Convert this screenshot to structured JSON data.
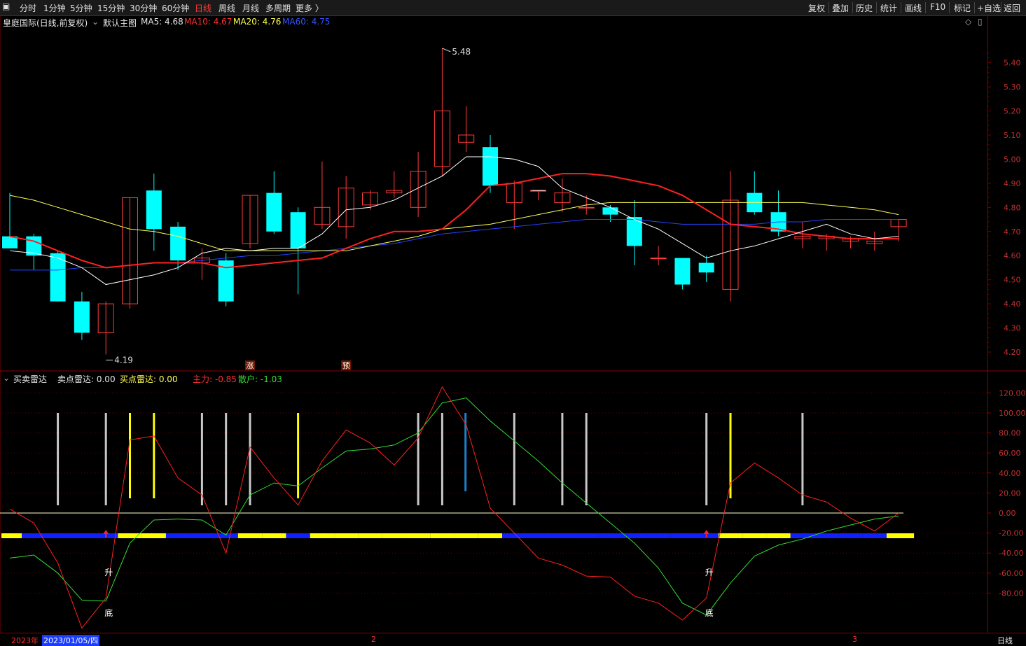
{
  "toolbar": {
    "periods": [
      "分时",
      "1分钟",
      "5分钟",
      "15分钟",
      "30分钟",
      "60分钟",
      "日线",
      "周线",
      "月线",
      "多周期",
      "更多 〉"
    ],
    "active_period": "日线",
    "right_buttons": [
      "复权",
      "叠加",
      "历史",
      "统计",
      "画线",
      "F10",
      "标记",
      "+自选",
      "返回"
    ]
  },
  "main_title": {
    "stock": "皇庭国际(日线,前复权)",
    "template": "默认主图",
    "ma5": "MA5: 4.68",
    "ma10": "MA10: 4.67",
    "ma20": "MA20: 4.76",
    "ma60": "MA60: 4.75"
  },
  "indicator_title": {
    "name": "买卖雷达",
    "sell": "卖点雷达: 0.00",
    "buy": "买点雷达: 0.00",
    "main_force": "主力: -0.85",
    "retail": "散户: -1.03"
  },
  "colors": {
    "up": "#ff3b3b",
    "down": "#00ffff",
    "ma5": "#ffffff",
    "ma10": "#ff2020",
    "ma20": "#ffff55",
    "ma60": "#2244ff",
    "main_force": "#ff2020",
    "retail": "#33dd33"
  },
  "bottom": {
    "year": "2023年",
    "date": "2023/01/05/四",
    "month2": "2",
    "month3": "3",
    "period": "日线"
  },
  "chart_data": [
    {
      "type": "candlestick",
      "y_ticks": [
        "5.40",
        "5.30",
        "5.20",
        "5.10",
        "5.00",
        "4.90",
        "4.80",
        "4.70",
        "4.60",
        "4.50",
        "4.40",
        "4.30",
        "4.20"
      ],
      "ylim": [
        4.15,
        5.5
      ],
      "candles": [
        {
          "o": 4.68,
          "h": 4.86,
          "l": 4.63,
          "c": 4.63
        },
        {
          "o": 4.68,
          "h": 4.69,
          "l": 4.54,
          "c": 4.6
        },
        {
          "o": 4.61,
          "h": 4.62,
          "l": 4.41,
          "c": 4.41
        },
        {
          "o": 4.41,
          "h": 4.45,
          "l": 4.25,
          "c": 4.28
        },
        {
          "o": 4.28,
          "h": 4.41,
          "l": 4.19,
          "c": 4.4
        },
        {
          "o": 4.4,
          "h": 4.84,
          "l": 4.38,
          "c": 4.84
        },
        {
          "o": 4.87,
          "h": 4.94,
          "l": 4.62,
          "c": 4.71
        },
        {
          "o": 4.72,
          "h": 4.74,
          "l": 4.54,
          "c": 4.58
        },
        {
          "o": 4.57,
          "h": 4.63,
          "l": 4.5,
          "c": 4.59
        },
        {
          "o": 4.58,
          "h": 4.61,
          "l": 4.39,
          "c": 4.41
        },
        {
          "o": 4.65,
          "h": 4.85,
          "l": 4.63,
          "c": 4.85
        },
        {
          "o": 4.86,
          "h": 4.95,
          "l": 4.69,
          "c": 4.7
        },
        {
          "o": 4.78,
          "h": 4.8,
          "l": 4.44,
          "c": 4.63
        },
        {
          "o": 4.73,
          "h": 4.99,
          "l": 4.71,
          "c": 4.8
        },
        {
          "o": 4.72,
          "h": 4.93,
          "l": 4.67,
          "c": 4.88
        },
        {
          "o": 4.81,
          "h": 4.87,
          "l": 4.79,
          "c": 4.86
        },
        {
          "o": 4.86,
          "h": 4.95,
          "l": 4.84,
          "c": 4.87
        },
        {
          "o": 4.8,
          "h": 5.03,
          "l": 4.76,
          "c": 4.95
        },
        {
          "o": 4.97,
          "h": 5.46,
          "l": 4.93,
          "c": 5.2
        },
        {
          "o": 5.07,
          "h": 5.22,
          "l": 5.03,
          "c": 5.1
        },
        {
          "o": 5.05,
          "h": 5.1,
          "l": 4.86,
          "c": 4.89
        },
        {
          "o": 4.82,
          "h": 4.91,
          "l": 4.71,
          "c": 4.9
        },
        {
          "o": 4.87,
          "h": 4.87,
          "l": 4.83,
          "c": 4.87
        },
        {
          "o": 4.82,
          "h": 4.92,
          "l": 4.78,
          "c": 4.86
        },
        {
          "o": 4.8,
          "h": 4.85,
          "l": 4.77,
          "c": 4.8
        },
        {
          "o": 4.8,
          "h": 4.81,
          "l": 4.74,
          "c": 4.77
        },
        {
          "o": 4.76,
          "h": 4.83,
          "l": 4.56,
          "c": 4.64
        },
        {
          "o": 4.59,
          "h": 4.64,
          "l": 4.56,
          "c": 4.59
        },
        {
          "o": 4.59,
          "h": 4.59,
          "l": 4.46,
          "c": 4.48
        },
        {
          "o": 4.57,
          "h": 4.6,
          "l": 4.49,
          "c": 4.53
        },
        {
          "o": 4.46,
          "h": 4.95,
          "l": 4.41,
          "c": 4.83
        },
        {
          "o": 4.86,
          "h": 4.95,
          "l": 4.77,
          "c": 4.78
        },
        {
          "o": 4.78,
          "h": 4.87,
          "l": 4.68,
          "c": 4.7
        },
        {
          "o": 4.67,
          "h": 4.74,
          "l": 4.63,
          "c": 4.68
        },
        {
          "o": 4.67,
          "h": 4.69,
          "l": 4.62,
          "c": 4.68
        },
        {
          "o": 4.66,
          "h": 4.68,
          "l": 4.63,
          "c": 4.67
        },
        {
          "o": 4.65,
          "h": 4.7,
          "l": 4.62,
          "c": 4.66
        },
        {
          "o": 4.72,
          "h": 4.75,
          "l": 4.66,
          "c": 4.75
        }
      ],
      "ma5": [
        4.62,
        4.61,
        4.59,
        4.55,
        4.48,
        4.5,
        4.52,
        4.55,
        4.61,
        4.63,
        4.62,
        4.63,
        4.63,
        4.69,
        4.79,
        4.8,
        4.83,
        4.88,
        4.93,
        5.01,
        5.01,
        5.0,
        4.97,
        4.88,
        4.84,
        4.8,
        4.75,
        4.71,
        4.65,
        4.59,
        4.62,
        4.64,
        4.67,
        4.7,
        4.73,
        4.69,
        4.67,
        4.68
      ],
      "ma10": [
        4.68,
        4.66,
        4.62,
        4.58,
        4.55,
        4.56,
        4.57,
        4.57,
        4.57,
        4.55,
        4.56,
        4.57,
        4.58,
        4.59,
        4.63,
        4.67,
        4.7,
        4.7,
        4.71,
        4.79,
        4.89,
        4.9,
        4.92,
        4.94,
        4.94,
        4.93,
        4.91,
        4.89,
        4.85,
        4.79,
        4.73,
        4.72,
        4.71,
        4.69,
        4.68,
        4.67,
        4.67,
        4.67
      ],
      "ma20": [
        4.85,
        4.83,
        4.8,
        4.77,
        4.74,
        4.71,
        4.7,
        4.68,
        4.65,
        4.62,
        4.62,
        4.62,
        4.62,
        4.62,
        4.62,
        4.64,
        4.66,
        4.68,
        4.71,
        4.72,
        4.73,
        4.75,
        4.77,
        4.79,
        4.81,
        4.82,
        4.82,
        4.82,
        4.82,
        4.82,
        4.82,
        4.82,
        4.82,
        4.82,
        4.81,
        4.8,
        4.79,
        4.77
      ],
      "ma60": [
        4.54,
        4.54,
        4.54,
        4.55,
        4.55,
        4.56,
        4.57,
        4.57,
        4.58,
        4.59,
        4.6,
        4.6,
        4.61,
        4.62,
        4.63,
        4.64,
        4.65,
        4.67,
        4.69,
        4.7,
        4.71,
        4.72,
        4.73,
        4.74,
        4.75,
        4.75,
        4.75,
        4.74,
        4.73,
        4.73,
        4.73,
        4.73,
        4.74,
        4.74,
        4.75,
        4.75,
        4.75,
        4.75
      ],
      "high_label": "5.48",
      "low_label": "4.19",
      "markers": [
        "涨",
        "预"
      ]
    },
    {
      "type": "line",
      "y_ticks": [
        "120.00",
        "100.00",
        "80.00",
        "60.00",
        "40.00",
        "20.00",
        "0.00",
        "-20.00",
        "-40.00",
        "-60.00",
        "-80.00"
      ],
      "ylim": [
        -115,
        130
      ],
      "series": [
        {
          "name": "主力",
          "values": [
            4,
            -10,
            -50,
            -115,
            -85,
            73,
            77,
            35,
            18,
            -40,
            66,
            35,
            8,
            52,
            83,
            70,
            48,
            75,
            126,
            88,
            5,
            -20,
            -45,
            -52,
            -63,
            -64,
            -83,
            -90,
            -107,
            -85,
            30,
            50,
            35,
            18,
            11,
            -5,
            -18,
            0
          ]
        },
        {
          "name": "散户",
          "values": [
            -45,
            -42,
            -60,
            -87,
            -88,
            -30,
            -7,
            -6,
            -7,
            -22,
            18,
            30,
            27,
            45,
            62,
            64,
            68,
            80,
            110,
            115,
            92,
            72,
            52,
            30,
            10,
            -10,
            -30,
            -55,
            -90,
            -102,
            -70,
            -43,
            -32,
            -26,
            -18,
            -12,
            -6,
            -3
          ]
        }
      ],
      "sell_bar_indices": [
        2,
        4,
        8,
        9,
        10,
        17,
        18,
        21,
        23,
        24,
        29,
        33
      ],
      "buy_bar_indices": [
        5,
        6,
        12,
        30
      ],
      "blue_bar_index": 19,
      "color_strip": [
        "yellow",
        "blue",
        "blue",
        "blue",
        "blue",
        "yellow",
        "yellow",
        "blue",
        "blue",
        "blue",
        "yellow",
        "yellow",
        "blue",
        "yellow",
        "yellow",
        "yellow",
        "yellow",
        "yellow",
        "yellow",
        "yellow",
        "yellow",
        "blue",
        "blue",
        "blue",
        "blue",
        "blue",
        "blue",
        "blue",
        "blue",
        "blue",
        "yellow",
        "yellow",
        "yellow",
        "blue",
        "blue",
        "blue",
        "blue",
        "yellow"
      ],
      "text_marks": [
        "升",
        "底",
        "升",
        "底"
      ],
      "arrow_indices": [
        4,
        29
      ]
    }
  ]
}
